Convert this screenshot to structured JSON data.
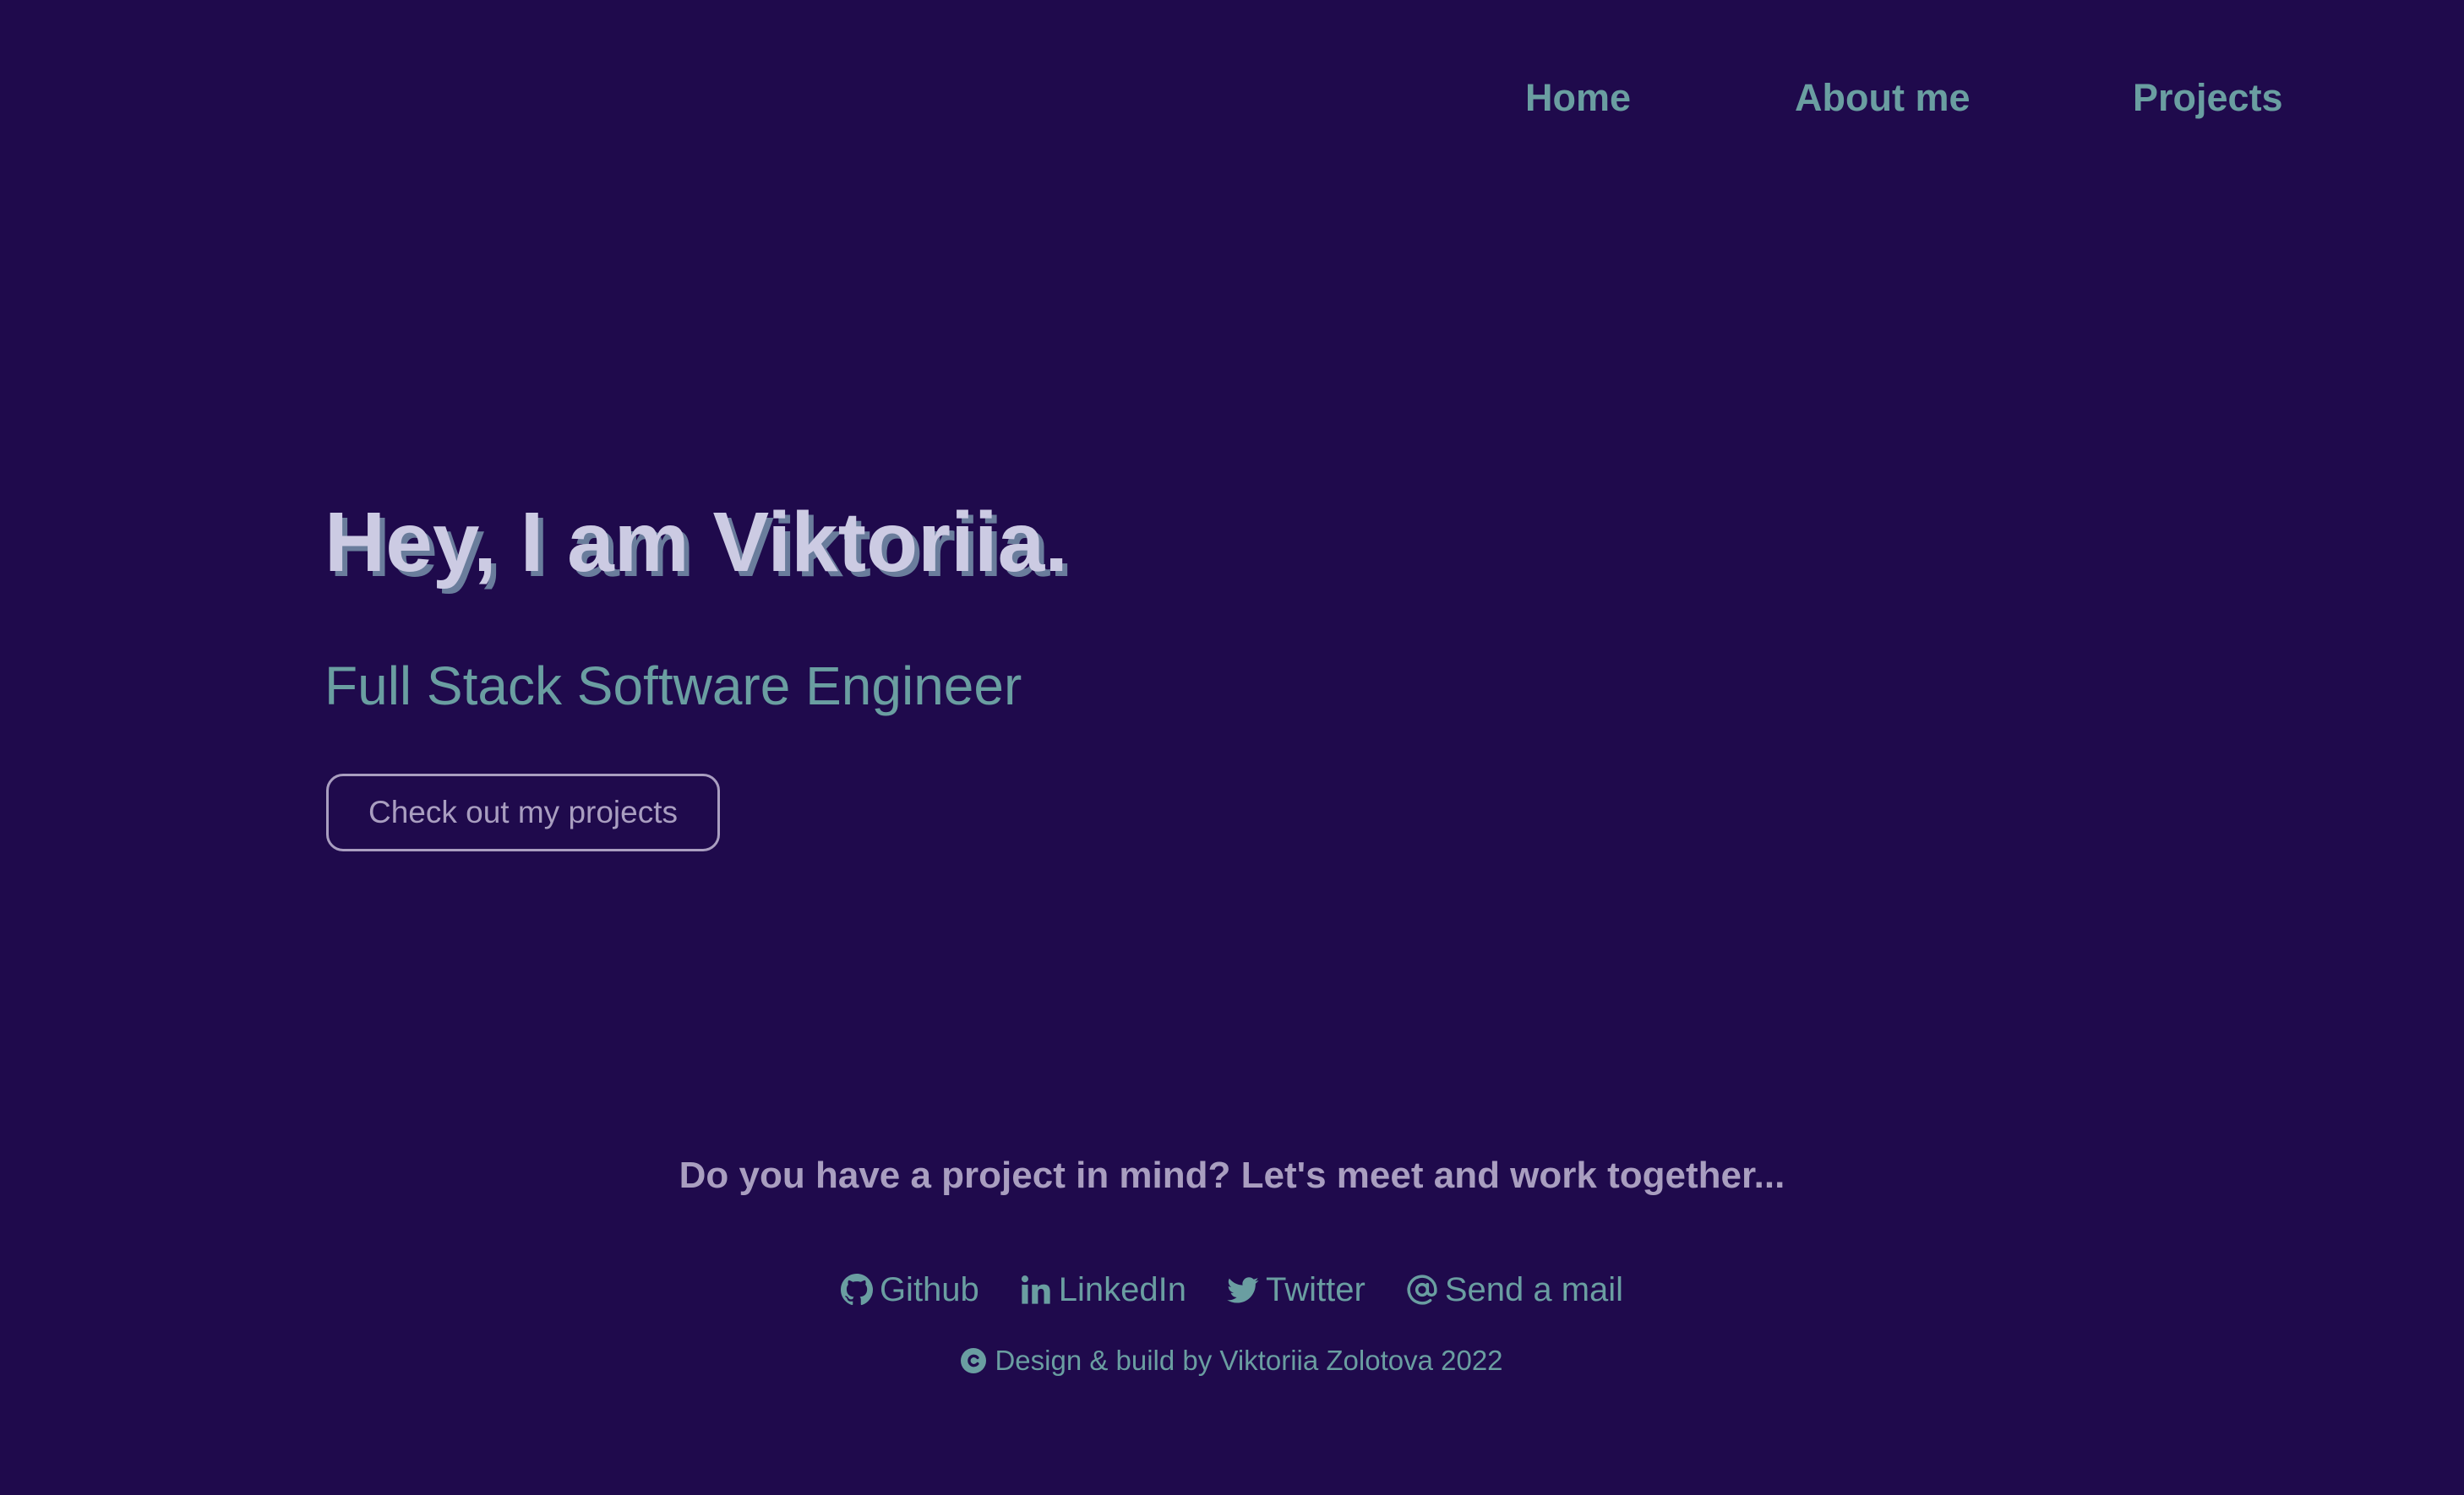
{
  "colors": {
    "background": "#1f0a4c",
    "accent_teal": "#6a9ea1",
    "title_text": "#cccbe3",
    "muted_lavender": "#a99ec0",
    "title_shadow": "#6a7d9c"
  },
  "nav": {
    "items": [
      {
        "label": "Home"
      },
      {
        "label": "About me"
      },
      {
        "label": "Projects"
      }
    ]
  },
  "hero": {
    "title": "Hey, I am Viktoriia.",
    "subtitle": "Full Stack Software Engineer",
    "button_label": "Check out my projects"
  },
  "footer": {
    "cta": "Do you have a project in mind? Let's meet and work together...",
    "links": [
      {
        "icon": "github-icon",
        "label": "Github"
      },
      {
        "icon": "linkedin-icon",
        "label": "LinkedIn"
      },
      {
        "icon": "twitter-icon",
        "label": "Twitter"
      },
      {
        "icon": "at-sign-icon",
        "label": "Send a mail"
      }
    ],
    "copyright_icon": "copyright-icon",
    "copyright": "Design & build by Viktoriia Zolotova 2022"
  }
}
